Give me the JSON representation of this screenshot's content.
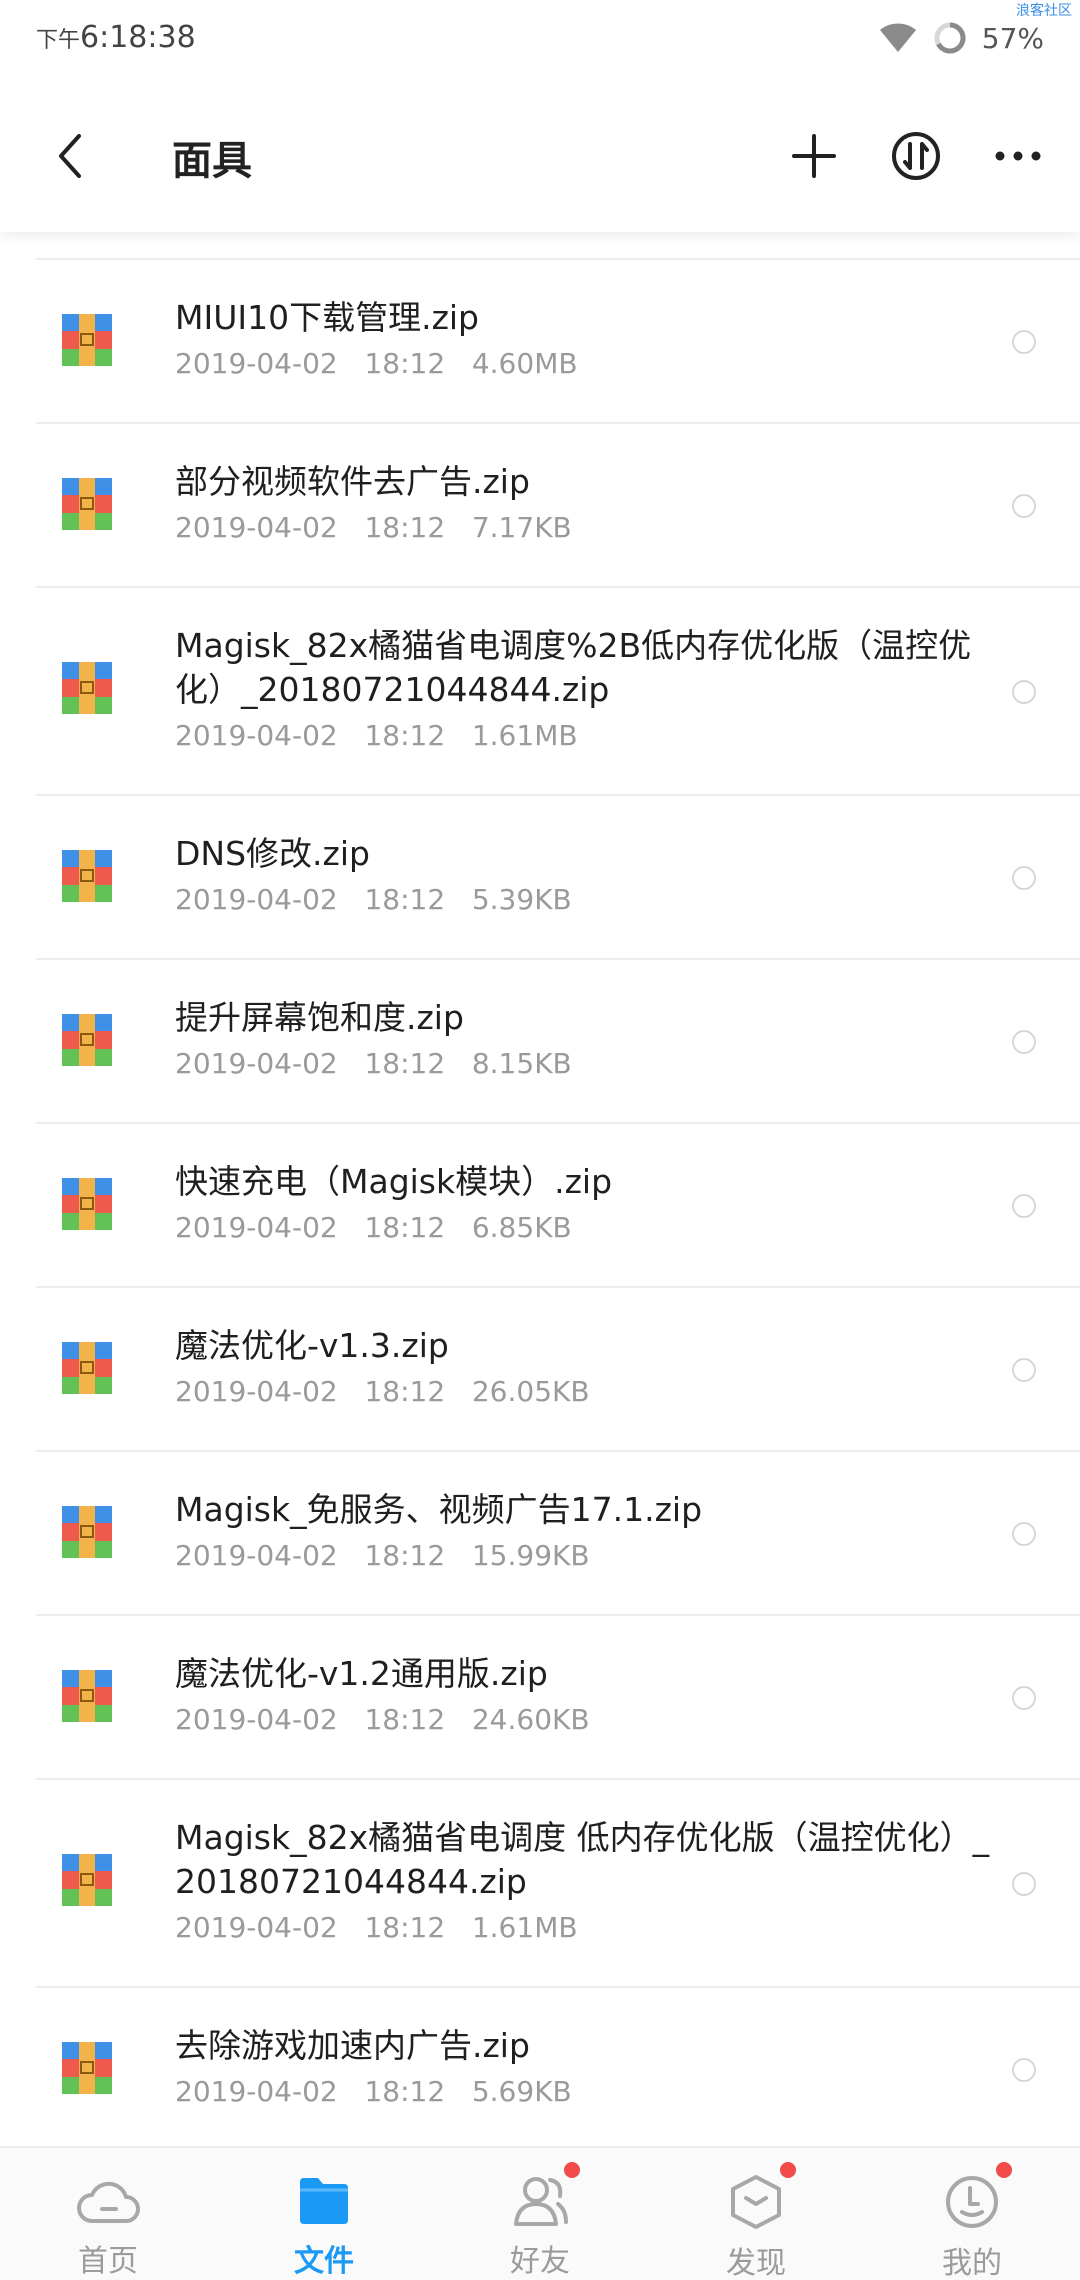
{
  "status_bar": {
    "time_prefix": "下午",
    "time": "6:18:38",
    "battery": "57%",
    "watermark": "浪客社区"
  },
  "header": {
    "title": "面具",
    "back_icon": "back-arrow-icon",
    "add_icon": "plus-icon",
    "sort_icon": "sort-icon",
    "more_icon": "more-dots-icon"
  },
  "files": [
    {
      "name": "MIUI10下载管理.zip",
      "date": "2019-04-02",
      "time": "18:12",
      "size": "4.60MB"
    },
    {
      "name": "部分视频软件去广告.zip",
      "date": "2019-04-02",
      "time": "18:12",
      "size": "7.17KB"
    },
    {
      "name": "Magisk_82x橘猫省电调度%2B低内存优化版（温控优化）_20180721044844.zip",
      "date": "2019-04-02",
      "time": "18:12",
      "size": "1.61MB"
    },
    {
      "name": "DNS修改.zip",
      "date": "2019-04-02",
      "time": "18:12",
      "size": "5.39KB"
    },
    {
      "name": "提升屏幕饱和度.zip",
      "date": "2019-04-02",
      "time": "18:12",
      "size": "8.15KB"
    },
    {
      "name": "快速充电（Magisk模块）.zip",
      "date": "2019-04-02",
      "time": "18:12",
      "size": "6.85KB"
    },
    {
      "name": "魔法优化-v1.3.zip",
      "date": "2019-04-02",
      "time": "18:12",
      "size": "26.05KB"
    },
    {
      "name": "Magisk_免服务、视频广告17.1.zip",
      "date": "2019-04-02",
      "time": "18:12",
      "size": "15.99KB"
    },
    {
      "name": "魔法优化-v1.2通用版.zip",
      "date": "2019-04-02",
      "time": "18:12",
      "size": "24.60KB"
    },
    {
      "name": "Magisk_82x橘猫省电调度 低内存优化版（温控优化）_20180721044844.zip",
      "date": "2019-04-02",
      "time": "18:12",
      "size": "1.61MB"
    },
    {
      "name": "去除游戏加速内广告.zip",
      "date": "2019-04-02",
      "time": "18:12",
      "size": "5.69KB"
    }
  ],
  "tabs": [
    {
      "label": "首页",
      "icon": "cloud-icon",
      "active": false,
      "badge": false
    },
    {
      "label": "文件",
      "icon": "folder-icon",
      "active": true,
      "badge": false
    },
    {
      "label": "好友",
      "icon": "friends-icon",
      "active": false,
      "badge": true
    },
    {
      "label": "发现",
      "icon": "discover-icon",
      "active": false,
      "badge": true
    },
    {
      "label": "我的",
      "icon": "profile-icon",
      "active": false,
      "badge": true
    }
  ],
  "colors": {
    "accent": "#1a9af4",
    "badge": "#f24b4b",
    "zip_blue": "#3f8fe6",
    "zip_red": "#ef5a4f",
    "zip_green": "#62c256",
    "zip_band": "#f2b34a"
  }
}
